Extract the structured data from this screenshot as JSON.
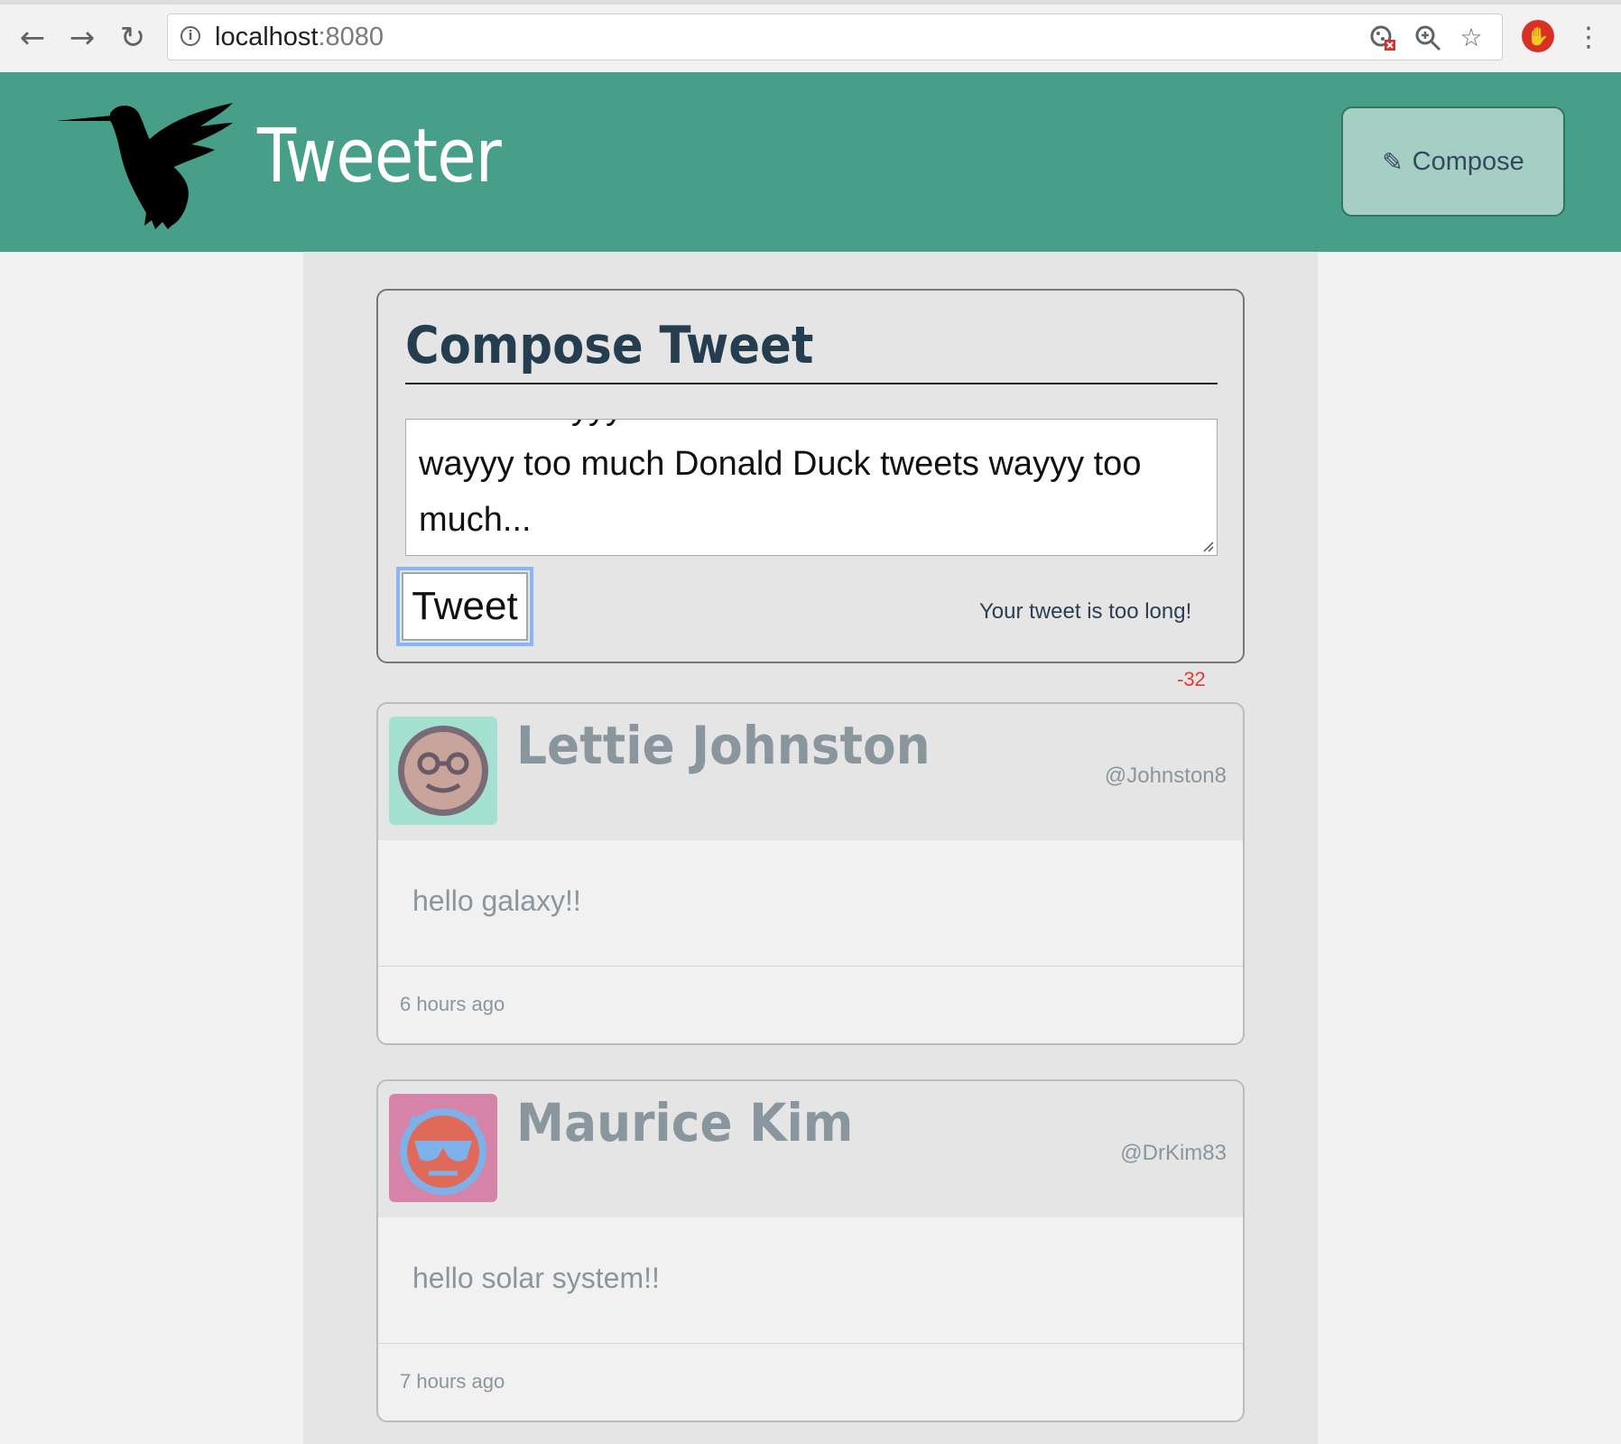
{
  "browser": {
    "url_host": "localhost",
    "url_port": ":8080",
    "icons": [
      "back-arrow-icon",
      "forward-arrow-icon",
      "reload-icon",
      "site-info-icon",
      "cookie-blocked-icon",
      "zoom-icon",
      "bookmark-star-icon",
      "adblock-extension-icon",
      "menu-dots-icon"
    ]
  },
  "header": {
    "brand": "Tweeter",
    "compose_label": "Compose",
    "background": "#479f89"
  },
  "compose": {
    "title": "Compose Tweet",
    "textarea_lines": [
      "tweets wayyy too much Donald Duck tweets",
      "wayyy too much Donald Duck tweets wayyy too",
      "much..."
    ],
    "tweet_button": "Tweet",
    "error": "Your tweet is too long!",
    "counter": "-32",
    "counter_color": "#e53935"
  },
  "tweets": [
    {
      "name": "Lettie Johnston",
      "handle": "@Johnston8",
      "body": "hello galaxy!!",
      "time": "6 hours ago",
      "avatar_bg": "#a3e0cf",
      "avatar_icon": "nerd-face-avatar-icon"
    },
    {
      "name": "Maurice Kim",
      "handle": "@DrKim83",
      "body": "hello solar system!!",
      "time": "7 hours ago",
      "avatar_bg": "#d583a8",
      "avatar_icon": "devil-sunglasses-avatar-icon"
    }
  ]
}
